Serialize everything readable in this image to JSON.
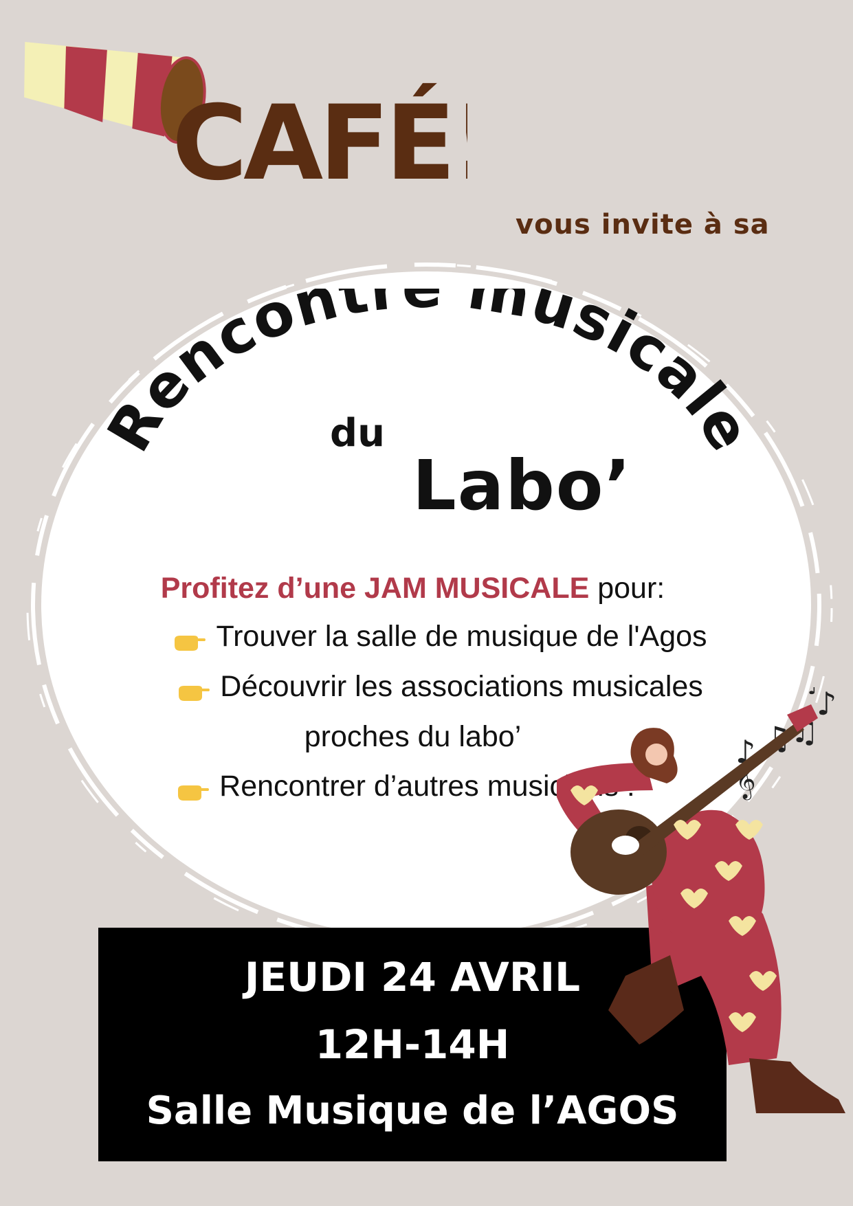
{
  "logo": {
    "text": "CAFÉ!",
    "tagline": "vous invite à sa"
  },
  "title": {
    "line1": "Rencontre musicale",
    "line2": "du",
    "line3": "Labo’"
  },
  "body": {
    "intro_accent": "Profitez d’une JAM MUSICALE",
    "intro_rest": " pour:",
    "bullets": [
      "Trouver la salle de musique de l'Agos",
      "Découvrir les associations musicales",
      "proches du labo’",
      "Rencontrer d’autres musiciens !"
    ]
  },
  "info": {
    "date": "JEUDI 24 AVRIL",
    "time": "12H-14H",
    "place": "Salle Musique de l’AGOS"
  },
  "colors": {
    "background": "#dcd6d2",
    "brown": "#5a2d12",
    "accent": "#b13a4a",
    "cream": "#f5f0b4"
  },
  "icons": [
    "coffee-cup-icon",
    "pointing-hand-icon",
    "music-notes-icon",
    "guitar-player-illustration"
  ]
}
